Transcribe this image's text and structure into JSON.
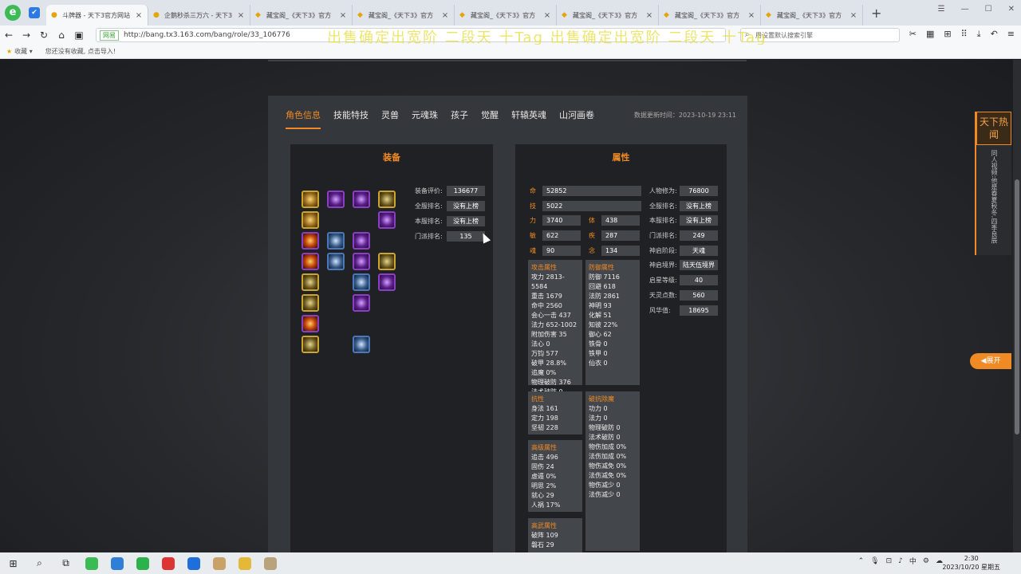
{
  "browser": {
    "tabs": [
      {
        "label": "斗牌器 - 天下3官方网站"
      },
      {
        "label": "企鹅秒杀三万六 - 天下3"
      },
      {
        "label": "藏宝阁_《天下3》官方"
      },
      {
        "label": "藏宝阁_《天下3》官方"
      },
      {
        "label": "藏宝阁_《天下3》官方"
      },
      {
        "label": "藏宝阁_《天下3》官方"
      },
      {
        "label": "藏宝阁_《天下3》官方"
      },
      {
        "label": "藏宝阁_《天下3》官方"
      }
    ],
    "secure_label": "网易",
    "url": "http://bang.tx3.163.com/bang/role/33_106776",
    "marquee_text": "出售确定出宽阶 二段天 十Tag 出售确定出宽阶 二段天 十Tag",
    "search_placeholder": "用设置默认搜索引擎",
    "bookmarks": [
      "收藏",
      "您还没有收藏, 点击导入!"
    ]
  },
  "page": {
    "nav_tabs": [
      "角色信息",
      "技能特技",
      "灵兽",
      "元魂珠",
      "孩子",
      "觉醒",
      "轩辕英魂",
      "山河画卷"
    ],
    "update_time": "数据更新时间：2023-10-19 23:11",
    "equip": {
      "title": "装备",
      "rows": [
        {
          "label": "装备评价:",
          "value": "136677"
        },
        {
          "label": "全服排名:",
          "value": "没有上榜"
        },
        {
          "label": "本服排名:",
          "value": "没有上榜"
        },
        {
          "label": "门派排名:",
          "value": "135"
        }
      ]
    },
    "attr": {
      "title": "属性",
      "base": [
        {
          "key": "命",
          "value": "52852"
        },
        {
          "key": "技",
          "value": "5022"
        },
        {
          "key": "力",
          "value": "3740"
        },
        {
          "key": "体",
          "value": "438"
        },
        {
          "key": "敏",
          "value": "622"
        },
        {
          "key": "疾",
          "value": "287"
        },
        {
          "key": "魂",
          "value": "90"
        },
        {
          "key": "念",
          "value": "134"
        }
      ],
      "attack": {
        "title": "攻击属性",
        "lines": [
          "攻力 2813-5584",
          "重击 1679",
          "命中 2560",
          "会心一击 437",
          "法力 652-1002",
          "附加伤害 35",
          "法心 0",
          "万钧 577",
          "破甲 28.8%",
          "追魔 0%",
          "物理破防 376",
          "法术破防 0"
        ]
      },
      "defense": {
        "title": "防御属性",
        "lines": [
          "防御 7116",
          "回避 618",
          "法防 2861",
          "神明 93",
          "化解 51",
          "知彼 22%",
          "御心 62",
          "铁骨 0",
          "铁甲 0",
          "仙衣 0"
        ]
      },
      "resist": {
        "title": "抗性",
        "lines": [
          "身法 161",
          "定力 198",
          "坚韧 228"
        ]
      },
      "break": {
        "title": "破抗除魔",
        "lines": [
          "功力 0",
          "法力 0",
          "物理破防 0",
          "法术破防 0",
          "物伤加成 0%",
          "法伤加成 0%",
          "物伤减免 0%",
          "法伤减免 0%",
          "物伤减少 0",
          "法伤减少 0"
        ]
      },
      "advanced": {
        "title": "高级属性",
        "lines": [
          "追击 496",
          "固伤 24",
          "虚遁 0%",
          "明思 2%",
          "就心 29",
          "人祸 17%"
        ]
      },
      "extra": {
        "title": "高武属性",
        "lines": [
          "破阵 109",
          "磐石 29"
        ]
      },
      "right": [
        {
          "label": "人物修为:",
          "value": "76800"
        },
        {
          "label": "全服排名:",
          "value": "没有上榜"
        },
        {
          "label": "本服排名:",
          "value": "没有上榜"
        },
        {
          "label": "门派排名:",
          "value": "249"
        },
        {
          "label": "神启阶段:",
          "value": "天魂"
        },
        {
          "label": "神启境界:",
          "value": "陆天伍境界"
        },
        {
          "label": "启星等级:",
          "value": "40"
        },
        {
          "label": "天灵点数:",
          "value": "560"
        },
        {
          "label": "风华值:",
          "value": "18695"
        }
      ]
    },
    "side_banner": {
      "title": "天下热闻",
      "text": "同人视频:他是春夏秋冬,四季良辰"
    },
    "expand_label": "◀展开"
  },
  "taskbar": {
    "tray_lang": "中",
    "time": "2:30",
    "date": "2023/10/20 星期五"
  }
}
